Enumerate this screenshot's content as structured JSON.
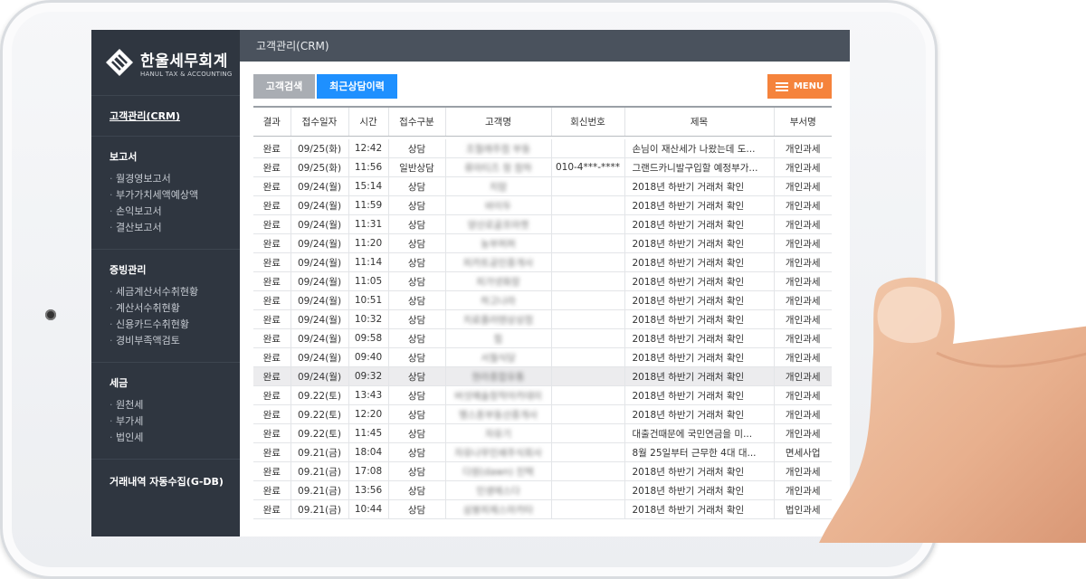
{
  "brand": {
    "name": "한울세무회계",
    "subtitle": "HANUL TAX & ACCOUNTING"
  },
  "topbar": {
    "title": "고객관리(CRM)"
  },
  "sidebar": {
    "top_link": "고객관리(CRM)",
    "sections": [
      {
        "heading": "보고서",
        "items": [
          "월경영보고서",
          "부가가치세액예상액",
          "손익보고서",
          "결산보고서"
        ]
      },
      {
        "heading": "증빙관리",
        "items": [
          "세금계산서수취현황",
          "계산서수취현황",
          "신용카드수취현황",
          "경비부족액검토"
        ]
      },
      {
        "heading": "세금",
        "items": [
          "원천세",
          "부가세",
          "법인세"
        ]
      },
      {
        "heading": "거래내역 자동수집(G-DB)",
        "items": []
      }
    ]
  },
  "tabs": {
    "search": "고객검색",
    "recent": "최근상담이력"
  },
  "menu_button": "MENU",
  "table": {
    "headers": [
      "결과",
      "접수일자",
      "시간",
      "접수구분",
      "고객명",
      "회신번호",
      "제목",
      "부서명"
    ],
    "rows": [
      [
        "완료",
        "09/25(화)",
        "12:42",
        "상담",
        "조철래주점 부동",
        "",
        "손님이 재산세가 나왔는데 도...",
        "개인과세"
      ],
      [
        "완료",
        "09/25(화)",
        "11:56",
        "일반상담",
        "류마티즈 정 참하",
        "010-4***-****",
        "그랜드카니발구입할 예정부가...",
        "개인과세"
      ],
      [
        "완료",
        "09/24(월)",
        "15:14",
        "상담",
        "치맘",
        "",
        "2018년 하반기 거래처 확인",
        "개인과세"
      ],
      [
        "완료",
        "09/24(월)",
        "11:59",
        "상담",
        "바이두",
        "",
        "2018년 하반기 거래처 확인",
        "개인과세"
      ],
      [
        "완료",
        "09/24(월)",
        "11:31",
        "상담",
        "양산로골프마켓",
        "",
        "2018년 하반기 거래처 확인",
        "개인과세"
      ],
      [
        "완료",
        "09/24(월)",
        "11:20",
        "상담",
        "농부퍼퍼",
        "",
        "2018년 하반기 거래처 확인",
        "개인과세"
      ],
      [
        "완료",
        "09/24(월)",
        "11:14",
        "상담",
        "피카트공인중개사",
        "",
        "2018년 하반기 거래처 확인",
        "개인과세"
      ],
      [
        "완료",
        "09/24(월)",
        "11:05",
        "상담",
        "피가넷화장",
        "",
        "2018년 하반기 거래처 확인",
        "개인과세"
      ],
      [
        "완료",
        "09/24(월)",
        "10:51",
        "상담",
        "하고나라",
        "",
        "2018년 하반기 거래처 확인",
        "개인과세"
      ],
      [
        "완료",
        "09/24(월)",
        "10:32",
        "상담",
        "치료플러텐상상점",
        "",
        "2018년 하반기 거래처 확인",
        "개인과세"
      ],
      [
        "완료",
        "09/24(월)",
        "09:58",
        "상담",
        "힘",
        "",
        "2018년 하반기 거래처 확인",
        "개인과세"
      ],
      [
        "완료",
        "09/24(월)",
        "09:40",
        "상담",
        "서월식당",
        "",
        "2018년 하반기 거래처 확인",
        "개인과세"
      ],
      [
        "완료",
        "09/24(월)",
        "09:32",
        "상담",
        "현라종합유통",
        "",
        "2018년 하반기 거래처 확인",
        "개인과세"
      ],
      [
        "완료",
        "09.22(토)",
        "13:43",
        "상담",
        "버섯예술창작아카데미",
        "",
        "2018년 하반기 거래처 확인",
        "개인과세"
      ],
      [
        "완료",
        "09.22(토)",
        "12:20",
        "상담",
        "행스톤부동산중개사",
        "",
        "2018년 하반기 거래처 확인",
        "개인과세"
      ],
      [
        "완료",
        "09.22(토)",
        "11:45",
        "상담",
        "자유기",
        "",
        "대출건때문에 국민연금을 미...",
        "개인과세"
      ],
      [
        "완료",
        "09.21(금)",
        "18:04",
        "상담",
        "자유나무인쇄주식회사",
        "",
        "8월 25일부터 근무한 4대 대...",
        "면세사업"
      ],
      [
        "완료",
        "09.21(금)",
        "17:08",
        "상담",
        "다원(dawn) 진택",
        "",
        "2018년 하반기 거래처 확인",
        "개인과세"
      ],
      [
        "완료",
        "09.21(금)",
        "13:56",
        "상담",
        "인생에스다",
        "",
        "2018년 하반기 거래처 확인",
        "개인과세"
      ],
      [
        "완료",
        "09.21(금)",
        "10:44",
        "상담",
        "삼봉피제스마카타",
        "",
        "2018년 하반기 거래처 확인",
        "법인과세"
      ]
    ],
    "highlight_row": 12
  },
  "colors": {
    "sidebar": "#2f3640",
    "topbar": "#4a525d",
    "tab_active": "#1e90ff",
    "tab_inactive": "#a9adb3",
    "menu": "#f5833c"
  }
}
